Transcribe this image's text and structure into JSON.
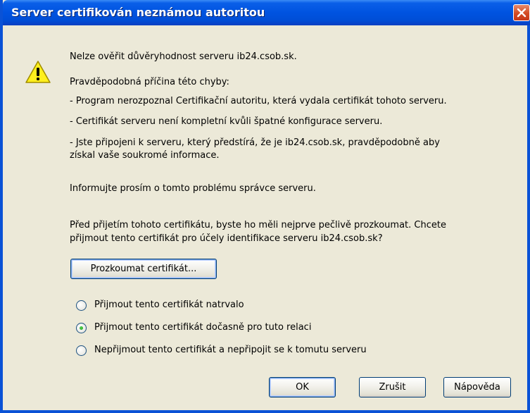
{
  "window": {
    "title": "Server certifikován neznámou autoritou",
    "close_icon": "close-icon"
  },
  "message": {
    "icon": "warning-icon",
    "line1": "Nelze ověřit důvěryhodnost serveru ib24.csob.sk.",
    "line2": "Pravděpodobná příčina této chyby:",
    "reason1": "- Program nerozpoznal Certifikační autoritu, která vydala certifikát tohoto serveru.",
    "reason2": "- Certifikát serveru není kompletní kvůli špatné konfigurace serveru.",
    "reason3_line1": "- Jste připojeni k serveru, který předstírá, že je ib24.csob.sk, pravděpodobně aby",
    "reason3_line2": "získal vaše soukromé informace.",
    "inform": "Informujte prosím o tomto problému správce serveru.",
    "before_line1": "Před přijetím tohoto certifikátu, byste ho měli nejprve pečlivě prozkoumat. Chcete",
    "before_line2": "přijmout tento certifikát pro účely identifikace serveru ib24.csob.sk?"
  },
  "examine_button": "Prozkoumat certifikát...",
  "options": [
    {
      "label": "Přijmout tento certifikát natrvalo",
      "selected": false
    },
    {
      "label": "Přijmout tento certifikát dočasně pro tuto relaci",
      "selected": true
    },
    {
      "label": "Nepřijmout tento certifikát a nepřipojit se k tomutu serveru",
      "selected": false
    }
  ],
  "buttons": {
    "ok": "OK",
    "cancel": "Zrušit",
    "help": "Nápověda"
  },
  "colors": {
    "titlebar": "#0053e0",
    "dialog_bg": "#ece9d8",
    "radio_selected": "#21a121"
  }
}
